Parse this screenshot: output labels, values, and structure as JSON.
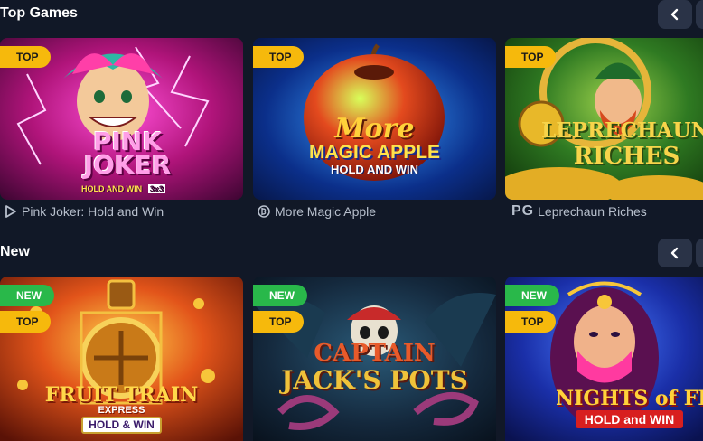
{
  "sections": [
    {
      "title": "Top Games",
      "games": [
        {
          "name": "Pink Joker: Hold and Win",
          "badges": [
            "TOP"
          ],
          "art_title": [
            "PINK",
            "JOKER"
          ],
          "art_subtitle": "HOLD AND WIN",
          "art_extra": "3x3",
          "provider_icon": "playson-provider-icon"
        },
        {
          "name": "More Magic Apple",
          "badges": [
            "TOP"
          ],
          "art_title": [
            "More",
            "MAGIC APPLE"
          ],
          "art_subtitle": "HOLD AND WIN",
          "provider_icon": "booongo-provider-icon"
        },
        {
          "name": "Leprechaun Riches",
          "badges": [
            "TOP"
          ],
          "art_title": [
            "LEPRECHAUN",
            "RICHES"
          ],
          "provider_icon": "pg-provider-icon",
          "provider_text": "PG"
        }
      ]
    },
    {
      "title": "New",
      "games": [
        {
          "badges": [
            "NEW",
            "TOP"
          ],
          "art_title": [
            "FRUIT TRAIN",
            "EXPRESS"
          ],
          "art_subtitle": "HOLD & WIN"
        },
        {
          "badges": [
            "NEW",
            "TOP"
          ],
          "art_title": [
            "CAPTAIN",
            "JACK'S POTS"
          ]
        },
        {
          "badges": [
            "NEW",
            "TOP"
          ],
          "art_title": [
            "NIGHTS of FIRE"
          ],
          "art_subtitle": "HOLD and WIN"
        }
      ]
    }
  ],
  "nav": {
    "prev_icon": "chevron-left-icon"
  },
  "colors": {
    "background": "#111827",
    "top_badge": "#f6b90c",
    "new_badge": "#29b84a",
    "nav_button": "#2a3347",
    "caption": "#b7bfcc"
  }
}
